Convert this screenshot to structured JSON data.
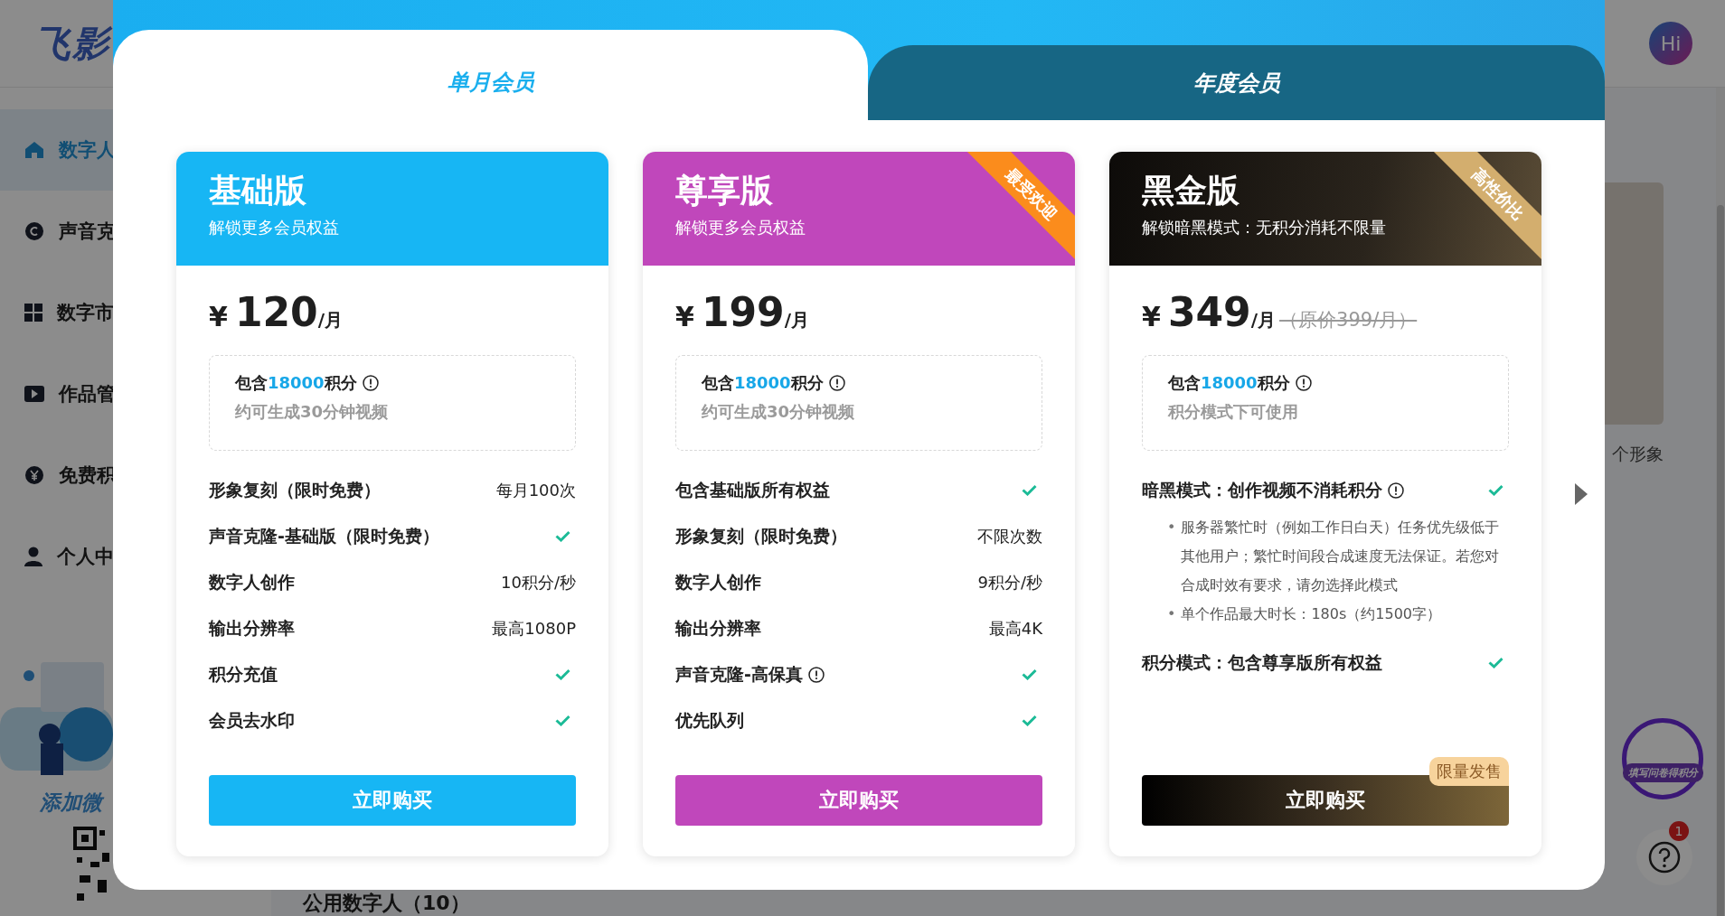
{
  "app": {
    "logo": "飞影",
    "sidebar": [
      {
        "label": "数字人",
        "selected": true
      },
      {
        "label": "声音克",
        "selected": false
      },
      {
        "label": "数字市",
        "selected": false
      },
      {
        "label": "作品管",
        "selected": false
      },
      {
        "label": "免费积",
        "selected": false
      },
      {
        "label": "个人中",
        "selected": false
      }
    ],
    "promo_text": "添加微",
    "avatar": "Hi",
    "gallery_caption": "个形象",
    "section_heading": "公用数字人（10）",
    "survey_badge": "填写问卷得积分",
    "help_badge": "1"
  },
  "modal": {
    "tabs": [
      {
        "label": "单月会员",
        "selected": true
      },
      {
        "label": "年度会员",
        "selected": false
      }
    ],
    "plans": [
      {
        "kind": "basic",
        "name": "基础版",
        "subtitle": "解锁更多会员权益",
        "currency": "¥",
        "price": "120",
        "unit": "/月",
        "credits": {
          "before": "包含",
          "amount": "18000",
          "after": "积分",
          "note": "约可生成30分钟视频"
        },
        "features": [
          {
            "label": "形象复刻（限时免费）",
            "kind": "value",
            "value": "每月100次",
            "info": false
          },
          {
            "label": "声音克隆-基础版（限时免费）",
            "kind": "check",
            "info": false
          },
          {
            "label": "数字人创作",
            "kind": "value",
            "value": "10积分/秒",
            "info": false
          },
          {
            "label": "输出分辨率",
            "kind": "value",
            "value": "最高1080P",
            "info": false
          },
          {
            "label": "积分充值",
            "kind": "check",
            "info": false
          },
          {
            "label": "会员去水印",
            "kind": "check",
            "info": false
          }
        ],
        "button": "立即购买"
      },
      {
        "kind": "premium",
        "name": "尊享版",
        "subtitle": "解锁更多会员权益",
        "ribbon": "最受欢迎",
        "currency": "¥",
        "price": "199",
        "unit": "/月",
        "credits": {
          "before": "包含",
          "amount": "18000",
          "after": "积分",
          "note": "约可生成30分钟视频"
        },
        "features": [
          {
            "label": "包含基础版所有权益",
            "kind": "check",
            "info": false
          },
          {
            "label": "形象复刻（限时免费）",
            "kind": "value",
            "value": "不限次数",
            "info": false
          },
          {
            "label": "数字人创作",
            "kind": "value",
            "value": "9积分/秒",
            "info": false
          },
          {
            "label": "输出分辨率",
            "kind": "value",
            "value": "最高4K",
            "info": false
          },
          {
            "label": "声音克隆-高保真",
            "kind": "check",
            "info": true
          },
          {
            "label": "优先队列",
            "kind": "check",
            "info": false
          }
        ],
        "button": "立即购买"
      },
      {
        "kind": "black",
        "name": "黑金版",
        "subtitle": "解锁暗黑模式：无积分消耗不限量",
        "ribbon": "高性价比",
        "currency": "¥",
        "price": "349",
        "unit": "/月",
        "original_price": "（原价399/月）",
        "credits": {
          "before": "包含",
          "amount": "18000",
          "after": "积分",
          "note": "积分模式下可使用"
        },
        "features": [
          {
            "label": "暗黑模式：创作视频不消耗积分",
            "kind": "check",
            "info": true,
            "notes": [
              {
                "marker": "•",
                "text": "服务器繁忙时（例如工作日白天）任务优先级低于其他用户；繁忙时间段合成速度无法保证。若您对合成时效有要求，请勿选择此模式"
              },
              {
                "marker": "•",
                "text": "单个作品最大时长：180s（约1500字）"
              }
            ]
          },
          {
            "label": "积分模式：包含尊享版所有权益",
            "kind": "check",
            "info": false
          }
        ],
        "button": "立即购买",
        "tag": "限量发售"
      }
    ]
  }
}
